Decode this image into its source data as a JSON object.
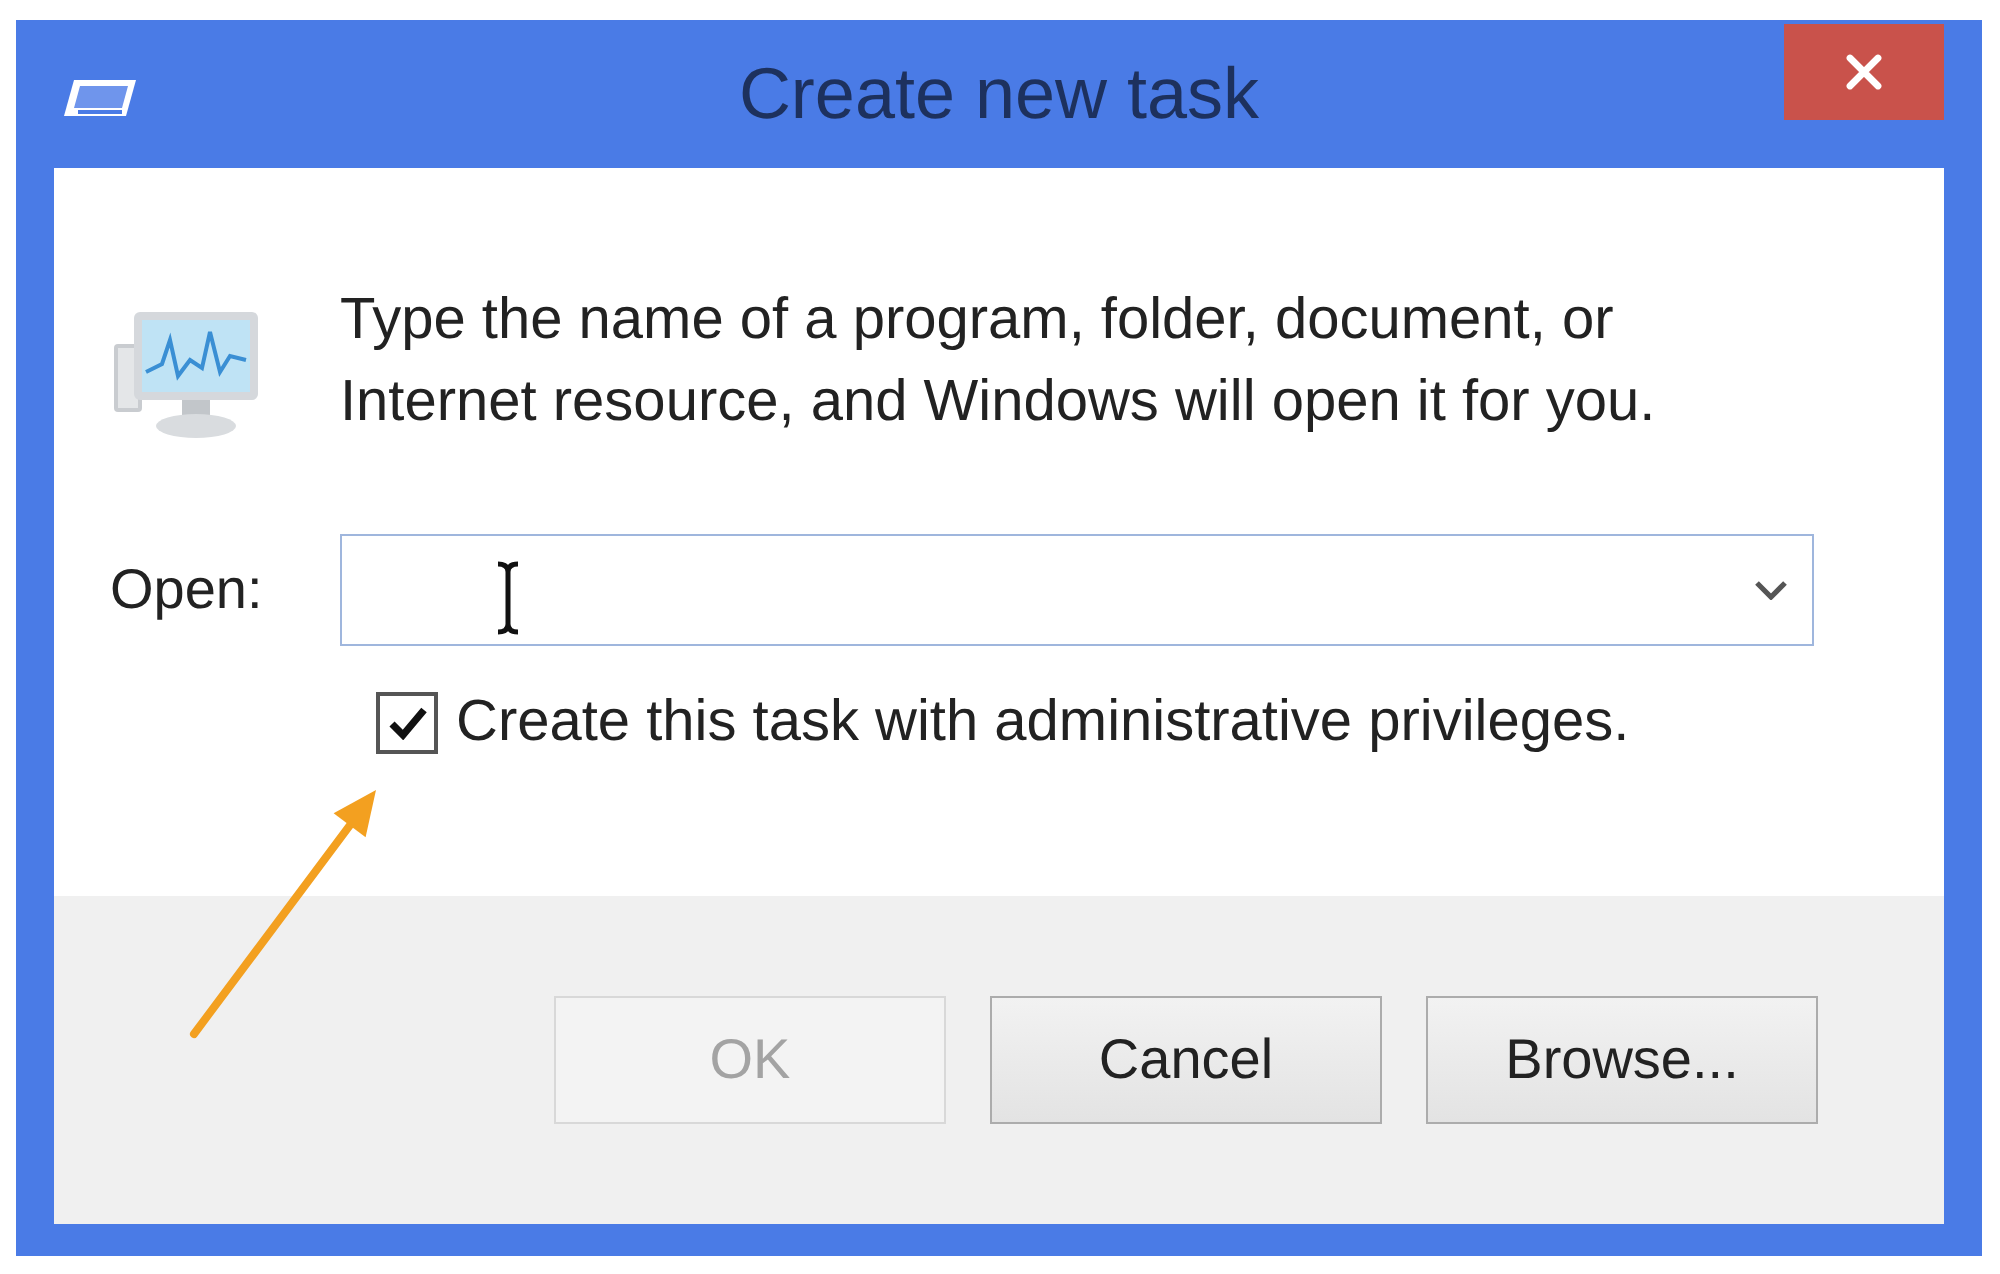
{
  "window": {
    "title": "Create new task"
  },
  "message": "Type the name of a program, folder, document, or Internet resource, and Windows will open it for you.",
  "open_field": {
    "label": "Open:"
  },
  "admin_checkbox": {
    "label": "Create this task with administrative privileges.",
    "checked": true
  },
  "buttons": [
    {
      "label": "OK",
      "disabled": true
    },
    {
      "label": "Cancel",
      "disabled": false
    },
    {
      "label": "Browse...",
      "disabled": false
    }
  ]
}
